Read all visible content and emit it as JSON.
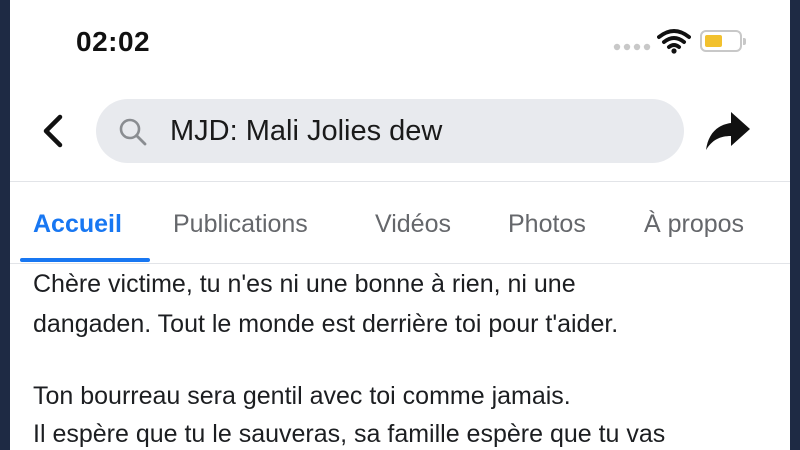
{
  "status_bar": {
    "time": "02:02",
    "battery_color": "#f2c12e"
  },
  "nav": {
    "back_icon": "chevron-left-icon",
    "search_icon": "search-icon",
    "search_text": "MJD: Mali Jolies dew",
    "share_icon": "share-arrow-icon"
  },
  "tabs": [
    {
      "label": "Accueil",
      "active": true
    },
    {
      "label": "Publications",
      "active": false
    },
    {
      "label": "Vidéos",
      "active": false
    },
    {
      "label": "Photos",
      "active": false
    },
    {
      "label": "À propos",
      "active": false
    }
  ],
  "colors": {
    "accent": "#1877f2",
    "tab_inactive": "#65676b",
    "search_bg": "#e8eaee"
  },
  "post": {
    "lines": [
      "Chère victime, tu n'es ni une bonne à rien, ni une",
      "dangaden. Tout le monde est derrière toi pour t'aider.",
      "",
      "Ton bourreau sera gentil avec toi comme jamais.",
      "Il espère que tu le sauveras, sa famille espère que tu vas"
    ]
  }
}
